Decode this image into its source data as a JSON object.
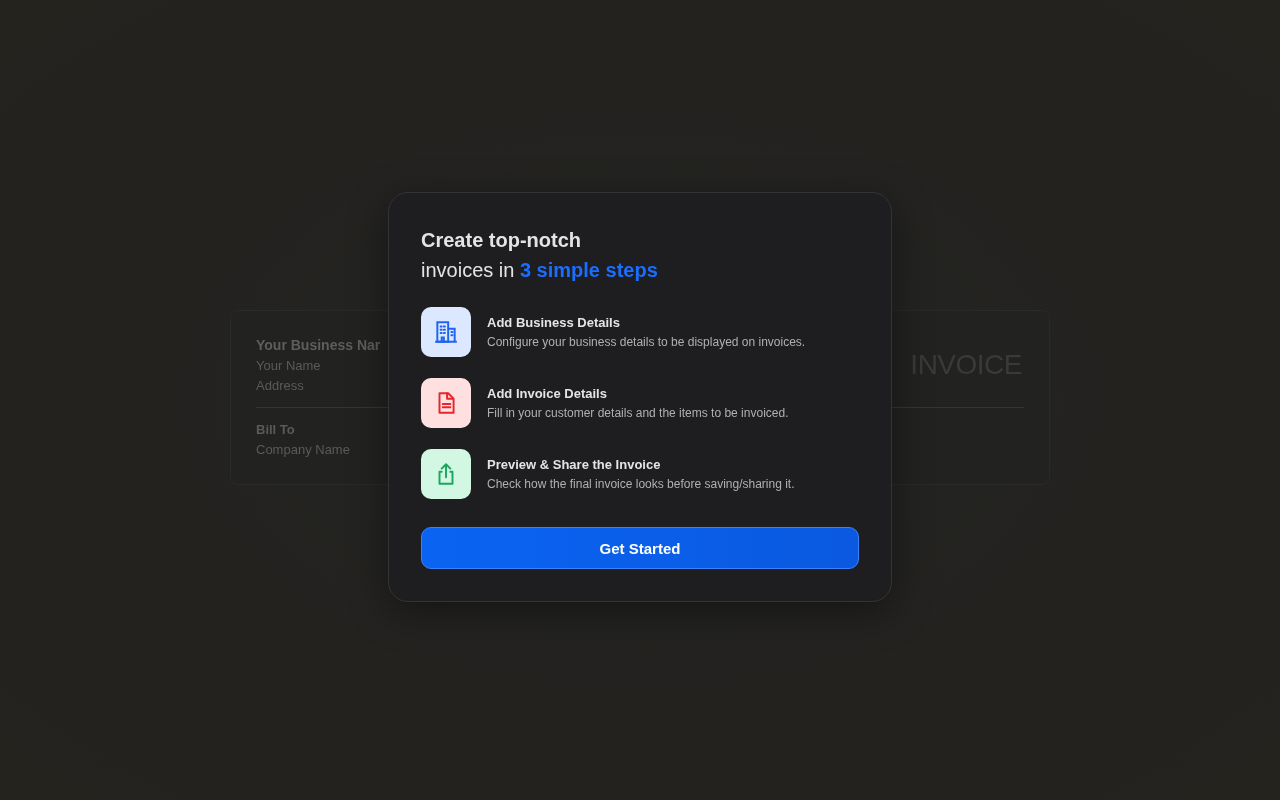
{
  "invoice_preview": {
    "business_name": "Your Business Nar",
    "your_name": "Your Name",
    "address": "Address",
    "heading": "INVOICE",
    "bill_to": "Bill To",
    "company_name": "Company Name"
  },
  "dialog": {
    "title_line_1": "Create top-notch",
    "title_line_2": "invoices in **3 simple steps**",
    "steps": [
      {
        "kind": "building",
        "color": "#dbe8ff",
        "title": "Add Business Details",
        "description": "Configure your business details to be displayed on invoices."
      },
      {
        "kind": "document",
        "color": "#ffe0e0",
        "title": "Add Invoice Details",
        "description": "Fill in your customer details and the items to be invoiced."
      },
      {
        "kind": "share",
        "color": "#d2f7e2",
        "title": "Preview & Share the Invoice",
        "description": "Check how the final invoice looks before saving/sharing it."
      }
    ],
    "button": "Get Started"
  }
}
